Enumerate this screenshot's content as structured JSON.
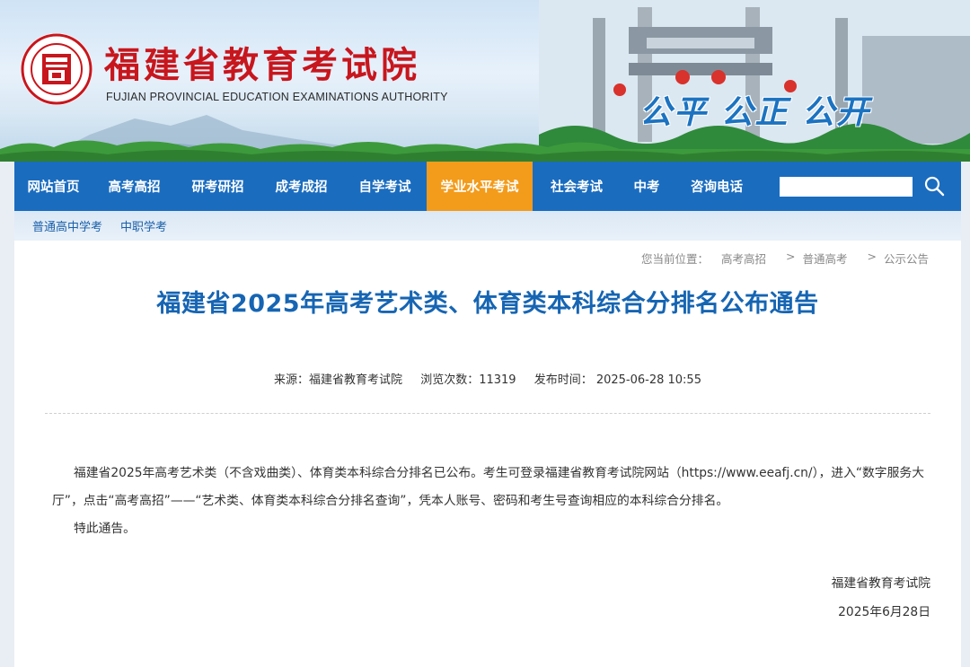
{
  "header": {
    "title": "福建省教育考试院",
    "subtitle": "FUJIAN PROVINCIAL EDUCATION EXAMINATIONS AUTHORITY",
    "slogan": "公平  公正  公开",
    "brand_red": "#c8161d",
    "logo_icon": "exam-authority-seal-icon"
  },
  "nav": {
    "items": [
      {
        "label": "网站首页"
      },
      {
        "label": "高考高招"
      },
      {
        "label": "研考研招"
      },
      {
        "label": "成考成招"
      },
      {
        "label": "自学考试"
      },
      {
        "label": "学业水平考试"
      },
      {
        "label": "社会考试"
      },
      {
        "label": "中考"
      },
      {
        "label": "咨询电话"
      }
    ],
    "active_index": 5,
    "search_placeholder": "",
    "search_icon": "search-icon",
    "bg_color": "#1a6cbf",
    "active_color": "#f39b1b"
  },
  "subnav": {
    "items": [
      {
        "label": "普通高中学考"
      },
      {
        "label": "中职学考"
      }
    ]
  },
  "breadcrumb": {
    "prefix": "您当前位置：",
    "items": [
      "高考高招",
      "普通高考",
      "公示公告"
    ],
    "separator": ">"
  },
  "article": {
    "title": "福建省2025年高考艺术类、体育类本科综合分排名公布通告",
    "source": "来源：福建省教育考试院",
    "views": "浏览次数：11319",
    "published": "发布时间：  2025-06-28 10:55",
    "paragraph1": "福建省2025年高考艺术类（不含戏曲类）、体育类本科综合分排名已公布。考生可登录福建省教育考试院网站（https://www.eeafj.cn/），进入“数字服务大厅”，点击“高考高招”——“艺术类、体育类本科综合分排名查询”，凭本人账号、密码和考生号查询相应的本科综合分排名。",
    "paragraph2": "特此通告。",
    "signature": "福建省教育考试院",
    "date": "2025年6月28日",
    "title_color": "#1665b3"
  }
}
